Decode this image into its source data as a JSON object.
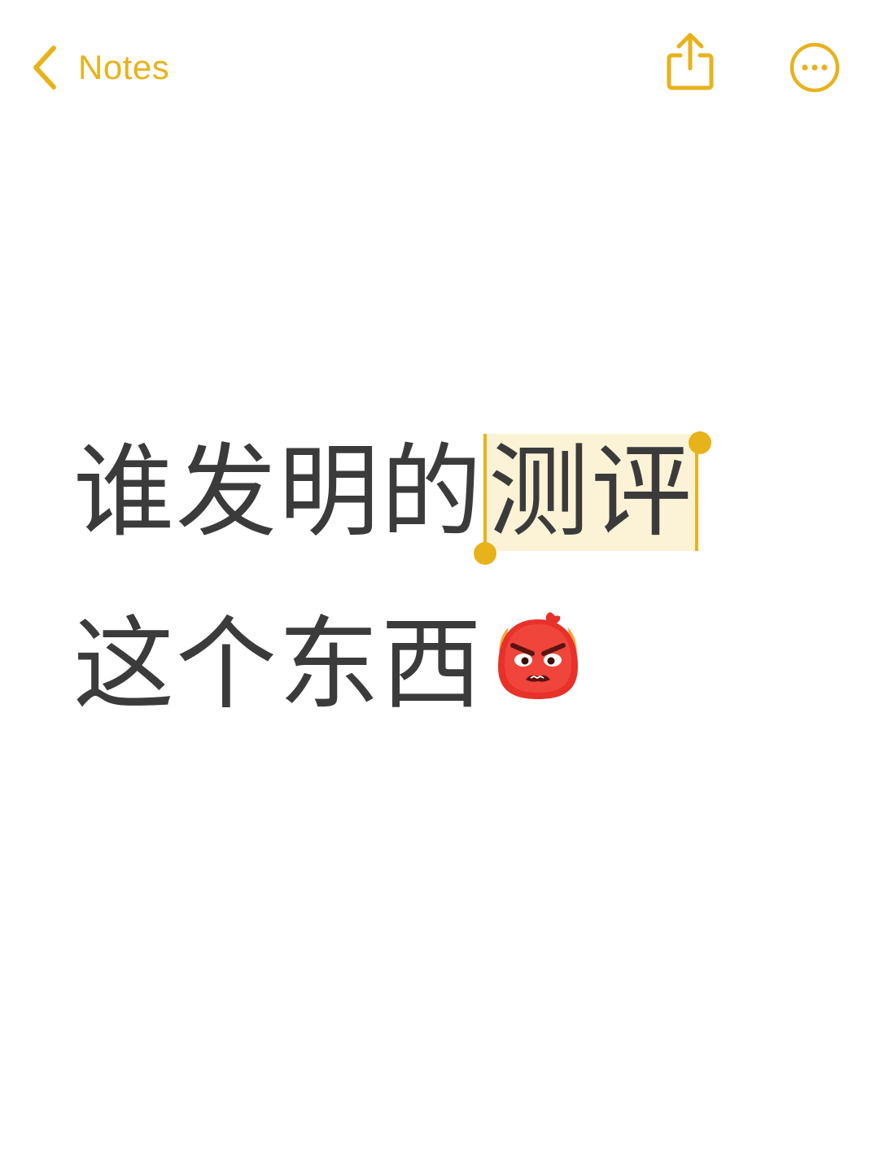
{
  "nav": {
    "back_label": "Notes",
    "accent_color": "#E8B21A",
    "back_icon": "chevron-left-icon",
    "share_icon": "share-icon",
    "more_icon": "ellipsis-circle-icon"
  },
  "note": {
    "line1_plain": "谁发明的",
    "line1_selected": "测评",
    "line2_text": "这个东西",
    "line2_emoji_icon": "angry-face-icon"
  }
}
